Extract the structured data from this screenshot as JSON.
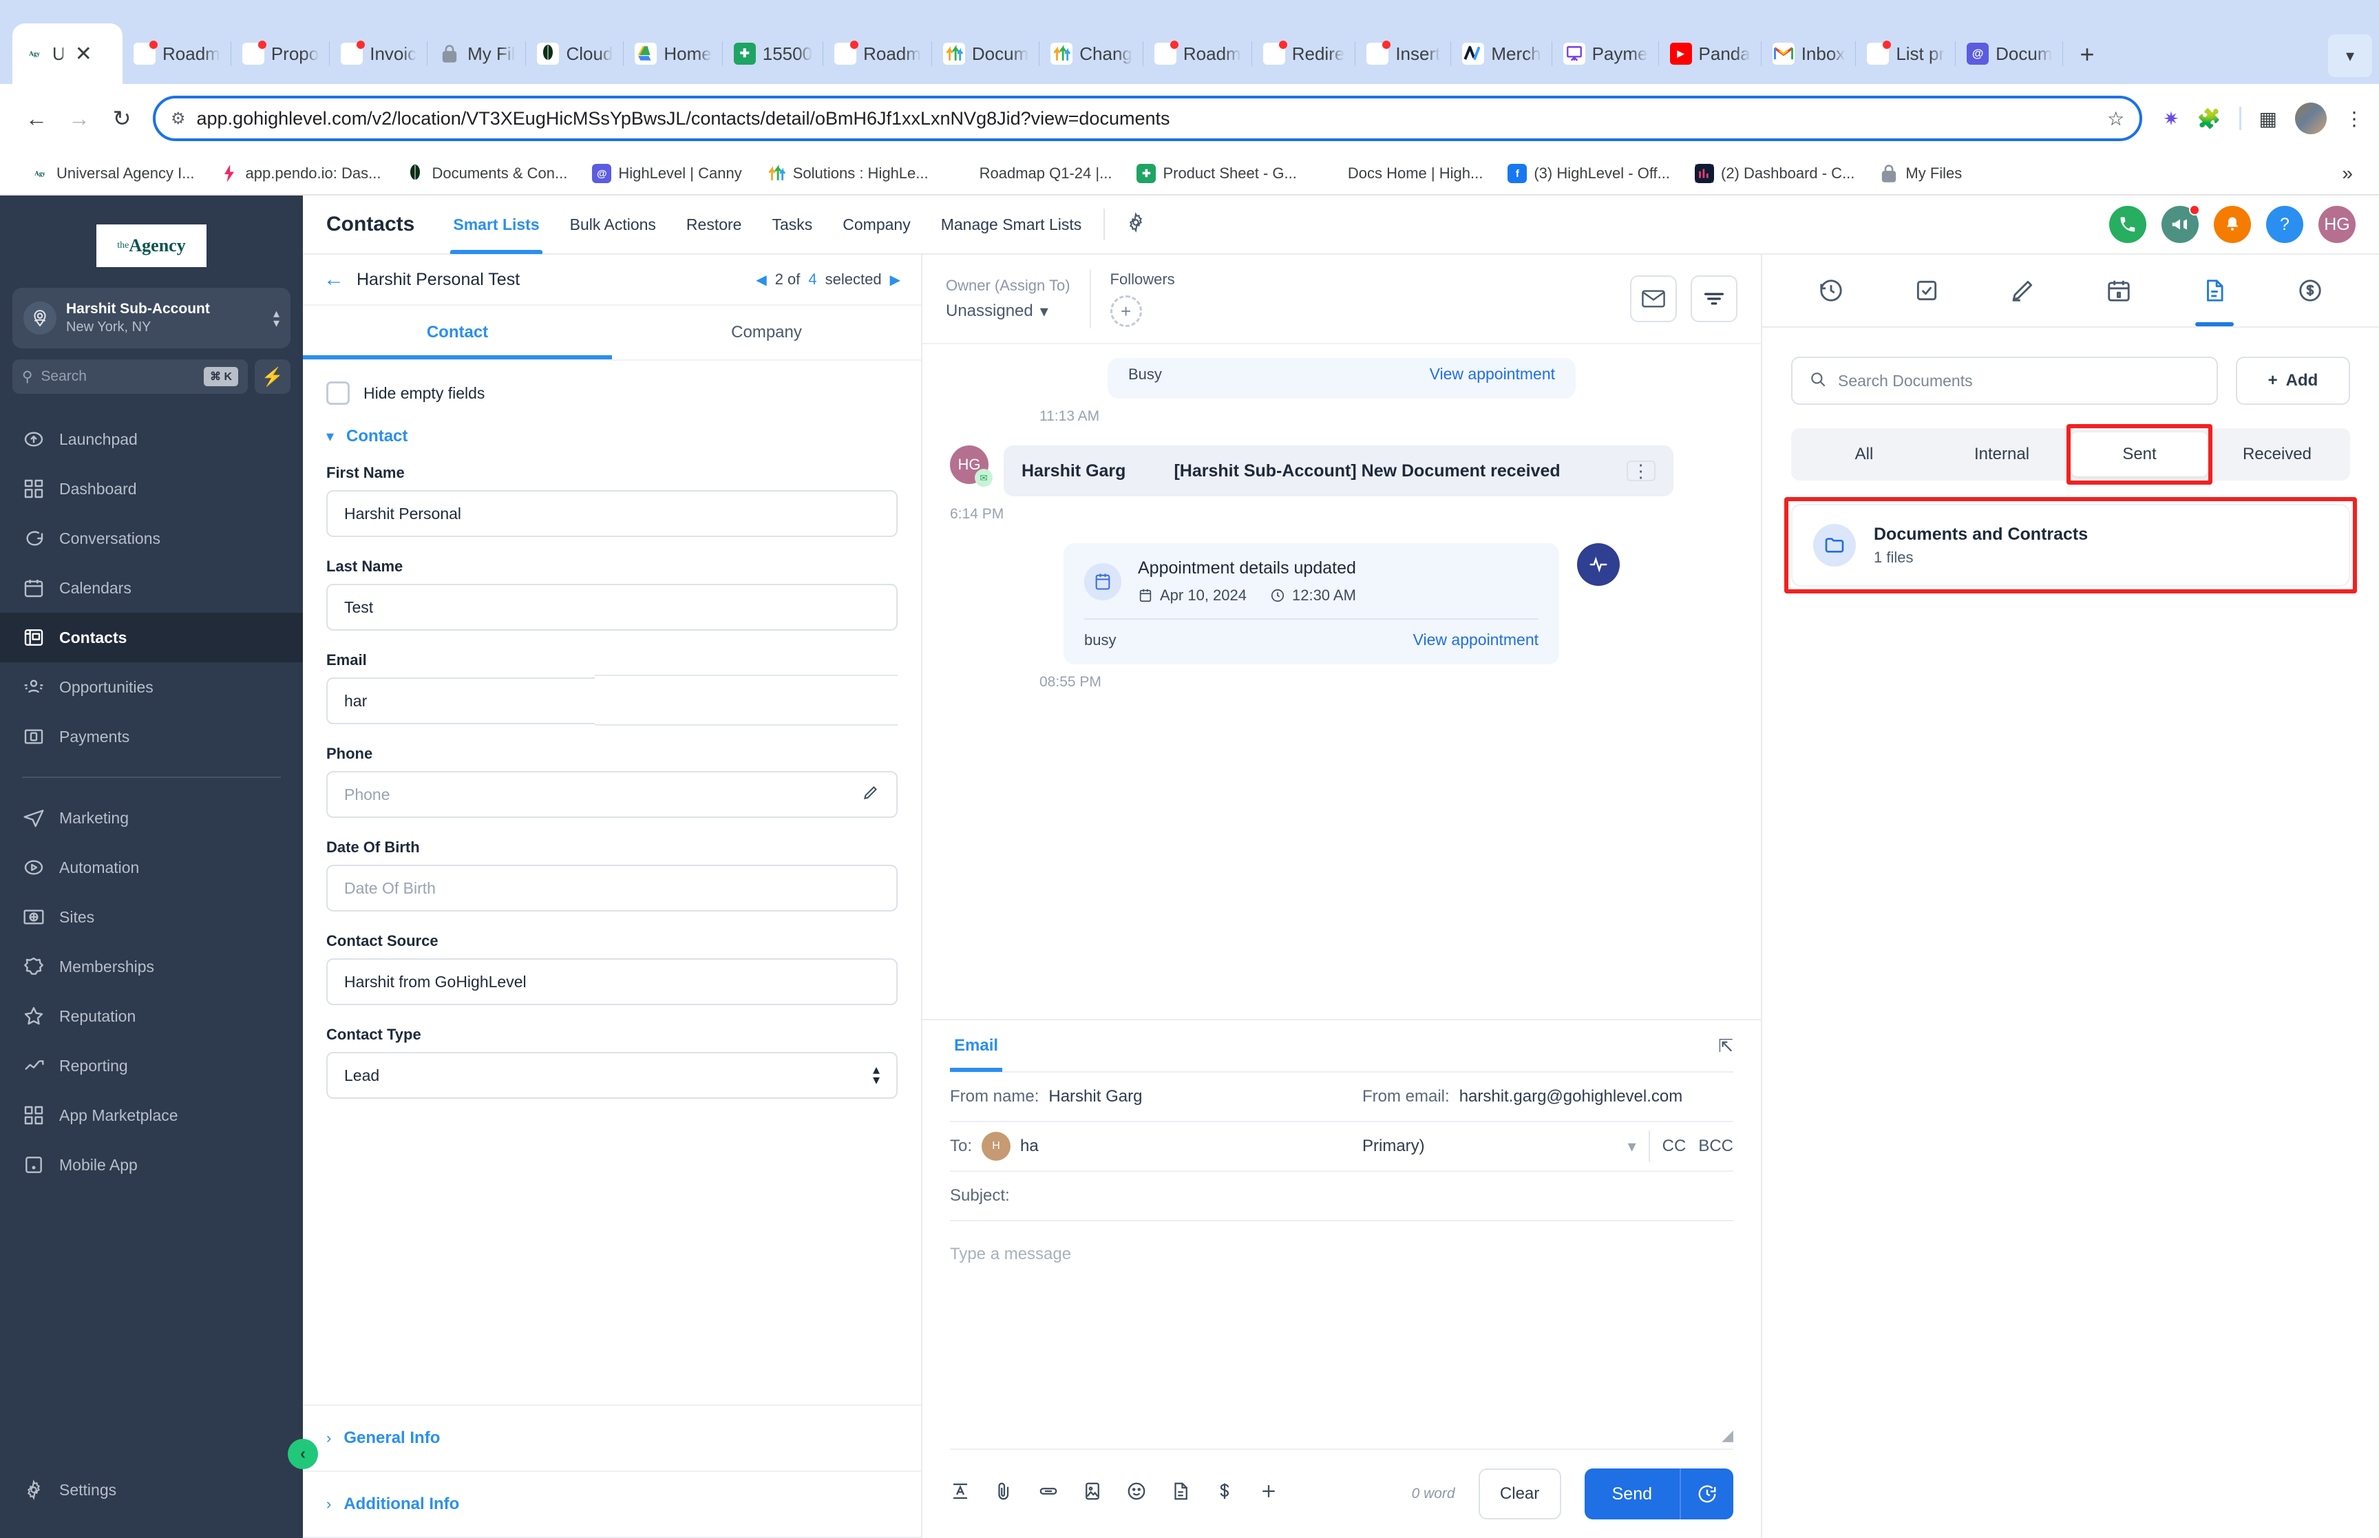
{
  "browser": {
    "tabs": [
      {
        "label": "U",
        "icon": "agency-logo",
        "active": true,
        "closable": true
      },
      {
        "label": "Roadm",
        "icon": "ghl-logo",
        "dot": true
      },
      {
        "label": "Propo",
        "icon": "ghl-logo",
        "dot": true
      },
      {
        "label": "Invoic",
        "icon": "ghl-logo",
        "dot": true
      },
      {
        "label": "My Fil",
        "icon": "lock-icon"
      },
      {
        "label": "Cloud",
        "icon": "mongodb-leaf"
      },
      {
        "label": "Home",
        "icon": "google-drive"
      },
      {
        "label": "15500",
        "icon": "google-sheets"
      },
      {
        "label": "Roadm",
        "icon": "ghl-logo",
        "dot": true
      },
      {
        "label": "Docum",
        "icon": "arrows-up"
      },
      {
        "label": "Chang",
        "icon": "arrows-up"
      },
      {
        "label": "Roadm",
        "icon": "ghl-logo",
        "dot": true
      },
      {
        "label": "Redire",
        "icon": "ghl-logo",
        "dot": true
      },
      {
        "label": "Insert",
        "icon": "ghl-logo",
        "dot": true
      },
      {
        "label": "Merch",
        "icon": "monday-logo"
      },
      {
        "label": "Payme",
        "icon": "purple-board"
      },
      {
        "label": "Panda",
        "icon": "youtube-logo"
      },
      {
        "label": "Inbox",
        "icon": "gmail-logo"
      },
      {
        "label": "List pr",
        "icon": "ghl-logo",
        "dot": true
      },
      {
        "label": "Docum",
        "icon": "canny-logo"
      }
    ],
    "new_tab_label": "+",
    "tab_list_chevron": "chevron-down-icon",
    "url": "app.gohighlevel.com/v2/location/VT3XEugHicMSsYpBwsJL/contacts/detail/oBmH6Jf1xxLxnNVg8Jid?view=documents",
    "bookmarks": [
      {
        "label": "Universal Agency I...",
        "icon": "agency-logo"
      },
      {
        "label": "app.pendo.io: Das...",
        "icon": "pendo-logo"
      },
      {
        "label": "Documents & Con...",
        "icon": "mongodb-leaf"
      },
      {
        "label": "HighLevel | Canny",
        "icon": "canny-logo"
      },
      {
        "label": "Solutions : HighLe...",
        "icon": "arrows-up"
      },
      {
        "label": "Roadmap Q1-24 |...",
        "icon": "ghl-logo"
      },
      {
        "label": "Product Sheet - G...",
        "icon": "google-sheets"
      },
      {
        "label": "Docs Home | High...",
        "icon": "ghl-logo"
      },
      {
        "label": "(3) HighLevel - Off...",
        "icon": "facebook-logo"
      },
      {
        "label": "(2) Dashboard - C...",
        "icon": "dark-chart-logo"
      },
      {
        "label": "My Files",
        "icon": "lock-icon"
      }
    ],
    "bookmarks_overflow": "»"
  },
  "sidebar": {
    "logo_small": "the",
    "logo_main": "Agency",
    "account_name": "Harshit Sub-Account",
    "account_location": "New York, NY",
    "search_placeholder": "Search",
    "search_shortcut": "⌘ K",
    "items": [
      {
        "label": "Launchpad",
        "icon": "rocket-icon"
      },
      {
        "label": "Dashboard",
        "icon": "dashboard-grid-icon"
      },
      {
        "label": "Conversations",
        "icon": "chat-bubble-icon"
      },
      {
        "label": "Calendars",
        "icon": "calendar-icon"
      },
      {
        "label": "Contacts",
        "icon": "contacts-card-icon",
        "active": true
      },
      {
        "label": "Opportunities",
        "icon": "opportunities-icon"
      },
      {
        "label": "Payments",
        "icon": "payments-icon"
      }
    ],
    "items2": [
      {
        "label": "Marketing",
        "icon": "paper-plane-icon"
      },
      {
        "label": "Automation",
        "icon": "automation-play-icon"
      },
      {
        "label": "Sites",
        "icon": "sites-globe-icon"
      },
      {
        "label": "Memberships",
        "icon": "membership-badge-icon"
      },
      {
        "label": "Reputation",
        "icon": "star-icon"
      },
      {
        "label": "Reporting",
        "icon": "trending-up-icon"
      },
      {
        "label": "App Marketplace",
        "icon": "marketplace-grid-icon"
      },
      {
        "label": "Mobile App",
        "icon": "mobile-app-icon"
      }
    ],
    "settings_label": "Settings",
    "settings_icon": "gear-icon",
    "collapse_icon": "chevron-left-icon"
  },
  "header": {
    "title": "Contacts",
    "nav": [
      {
        "label": "Smart Lists",
        "active": true
      },
      {
        "label": "Bulk Actions"
      },
      {
        "label": "Restore"
      },
      {
        "label": "Tasks"
      },
      {
        "label": "Company"
      },
      {
        "label": "Manage Smart Lists"
      }
    ],
    "gear_icon": "gear-icon",
    "actions": [
      {
        "name": "phone-call-icon",
        "glyph": "✆",
        "color": "#27ae60"
      },
      {
        "name": "megaphone-icon",
        "glyph": "📢",
        "color": "#4c9182",
        "dot": true
      },
      {
        "name": "notifications-bell-icon",
        "glyph": "🔔",
        "color": "#f57c00"
      },
      {
        "name": "help-icon",
        "glyph": "?",
        "color": "#2a8ff0"
      },
      {
        "name": "user-avatar",
        "glyph": "HG",
        "color": "#b5708f"
      }
    ]
  },
  "contact_panel": {
    "back_icon": "arrow-left-icon",
    "contact_name": "Harshit Personal Test",
    "pager_prev": "◀",
    "pager_next": "▶",
    "pager_current": "2 of",
    "pager_total": "4",
    "pager_suffix": "selected",
    "tabs": [
      {
        "label": "Contact",
        "active": true
      },
      {
        "label": "Company"
      }
    ],
    "hide_empty_label": "Hide empty fields",
    "section_label": "Contact",
    "fields": [
      {
        "label": "First Name",
        "value": "Harshit Personal",
        "placeholder": "",
        "edit": false
      },
      {
        "label": "Last Name",
        "value": "Test",
        "placeholder": "",
        "edit": false
      },
      {
        "label": "Email",
        "value": "har",
        "placeholder": "",
        "edit": true
      },
      {
        "label": "Phone",
        "value": "",
        "placeholder": "Phone",
        "edit": true
      },
      {
        "label": "Date Of Birth",
        "value": "",
        "placeholder": "Date Of Birth",
        "edit": false
      },
      {
        "label": "Contact Source",
        "value": "Harshit from GoHighLevel",
        "placeholder": "",
        "edit": false
      },
      {
        "label": "Contact Type",
        "value": "Lead",
        "placeholder": "",
        "select": true
      }
    ],
    "collapsed_sections": [
      {
        "label": "General Info"
      },
      {
        "label": "Additional Info"
      }
    ]
  },
  "conversation": {
    "owner_caption": "Owner (Assign To)",
    "owner_value": "Unassigned",
    "followers_caption": "Followers",
    "add_follower_icon": "plus-icon",
    "email_icon": "envelope-icon",
    "filter_icon": "filter-icon",
    "items": [
      {
        "type": "appointment_partial",
        "status": "Busy",
        "link": "View appointment",
        "timestamp": "11:13 AM"
      },
      {
        "type": "message",
        "avatar": "HG",
        "sender": "Harshit Garg",
        "subject": "[Harshit Sub-Account] New Document received",
        "menu_icon": "kebab-menu-icon",
        "timestamp": "6:14 PM"
      },
      {
        "type": "appointment",
        "title": "Appointment details updated",
        "date": "Apr 10, 2024",
        "time": "12:30 AM",
        "status": "busy",
        "link": "View appointment",
        "timestamp": "08:55 PM"
      }
    ]
  },
  "composer": {
    "tab_label": "Email",
    "expand_icon": "expand-icon",
    "from_name_label": "From name:",
    "from_name_value": "Harshit  Garg",
    "from_email_label": "From email:",
    "from_email_value": "harshit.garg@gohighlevel.com",
    "to_label": "To:",
    "to_avatar": "H",
    "to_value": "ha",
    "to_select_value": "Primary)",
    "cc_label": "CC",
    "bcc_label": "BCC",
    "subject_label": "Subject:",
    "subject_value": "",
    "body_placeholder": "Type a message",
    "toolbar_icons": [
      {
        "name": "text-format-icon",
        "glyph": "A"
      },
      {
        "name": "attachment-icon",
        "glyph": "📎"
      },
      {
        "name": "link-icon",
        "glyph": "⚙"
      },
      {
        "name": "image-icon",
        "glyph": "🖼"
      },
      {
        "name": "emoji-icon",
        "glyph": "☺"
      },
      {
        "name": "document-icon",
        "glyph": "🗎"
      },
      {
        "name": "dollar-icon",
        "glyph": "$"
      },
      {
        "name": "add-more-icon",
        "glyph": "+"
      }
    ],
    "word_count": "0 word",
    "clear_label": "Clear",
    "send_label": "Send",
    "schedule_icon": "clock-icon"
  },
  "right_panel": {
    "tabs": [
      {
        "name": "activity-clock-icon",
        "glyph": "◴",
        "active": false
      },
      {
        "name": "tasks-check-icon",
        "glyph": "☑",
        "active": false
      },
      {
        "name": "notes-pen-icon",
        "glyph": "✎",
        "active": false
      },
      {
        "name": "appointments-calendar-icon",
        "glyph": "Ὄ5",
        "active": false
      },
      {
        "name": "documents-icon",
        "glyph": "Ὄ4",
        "active": true
      },
      {
        "name": "payments-dollar-icon",
        "glyph": "$",
        "active": false
      }
    ],
    "search_placeholder": "Search Documents",
    "search_icon": "search-icon",
    "add_label": "Add",
    "add_icon": "plus-icon",
    "segments": [
      {
        "label": "All",
        "active": false
      },
      {
        "label": "Internal",
        "active": false
      },
      {
        "label": "Sent",
        "active": true,
        "highlighted": true
      },
      {
        "label": "Received",
        "active": false
      }
    ],
    "documents": [
      {
        "icon": "folder-icon",
        "title": "Documents and Contracts",
        "subtitle": "1 files",
        "highlighted": true
      }
    ],
    "highlight_color": "#f42020"
  }
}
